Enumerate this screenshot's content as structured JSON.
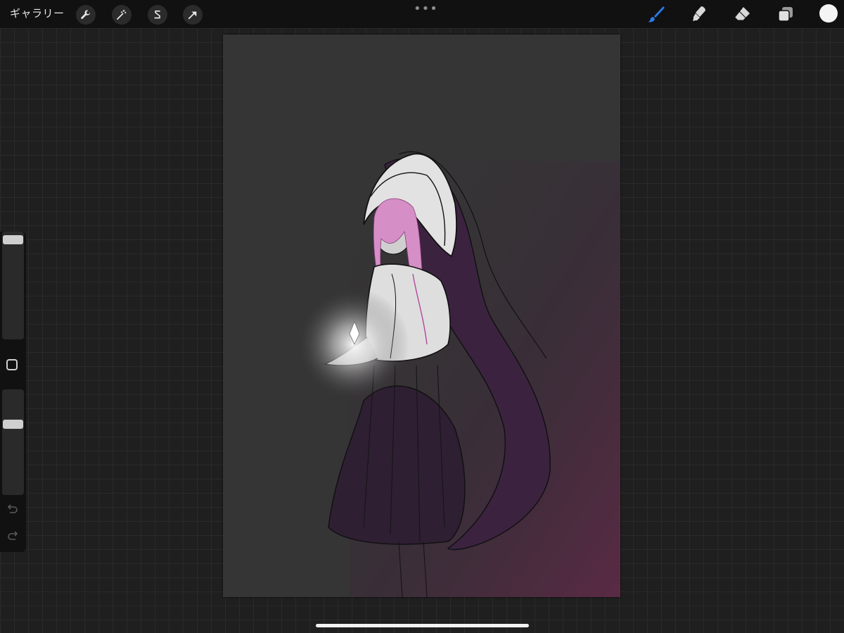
{
  "toolbar": {
    "gallery_label": "ギャラリー",
    "left_tools": [
      "wrench-icon",
      "magic-wand-icon",
      "selection-s-icon",
      "transform-arrow-icon"
    ],
    "more_label": "•••",
    "right_tools": [
      "brush-icon",
      "smudge-icon",
      "eraser-icon",
      "layers-icon",
      "color-icon"
    ],
    "active_tool": "brush",
    "active_color": "#1f7ae0",
    "current_color": "#f4f4f4"
  },
  "sidebar": {
    "brush_size_level": 0.0,
    "opacity_level": 0.45,
    "modify_button": "modify-square-icon",
    "undo": "undo-icon",
    "redo": "redo-icon"
  },
  "canvas": {
    "background": "#353535",
    "accent_glow": "#5a2a44"
  }
}
